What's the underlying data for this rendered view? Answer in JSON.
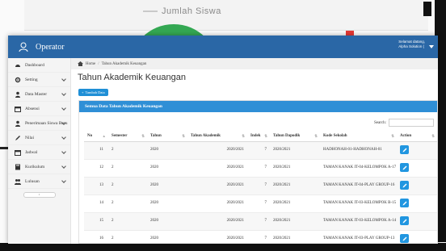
{
  "background": {
    "header_text": "Jumlah Siswa"
  },
  "app": {
    "name": "Operator",
    "user_line1": "Selamat datang,",
    "user_line2": "Alpha Solution (",
    "accent_color": "#2a67a6",
    "panel_color": "#2f8fd6"
  },
  "sidebar": {
    "items": [
      {
        "label": "Dashboard",
        "icon": "dashboard-icon",
        "has_caret": false
      },
      {
        "label": "Setting",
        "icon": "gear-icon",
        "has_caret": true
      },
      {
        "label": "Data Master",
        "icon": "user-icon",
        "has_caret": true
      },
      {
        "label": "Absensi",
        "icon": "calendar-icon",
        "has_caret": true
      },
      {
        "label": "Penerimaan Siswa Baru",
        "icon": "user-icon",
        "has_caret": true
      },
      {
        "label": "Nilai",
        "icon": "pencil-icon",
        "has_caret": true
      },
      {
        "label": "Jadwal",
        "icon": "calendar-icon",
        "has_caret": true
      },
      {
        "label": "Kurikulum",
        "icon": "book-icon",
        "has_caret": true
      },
      {
        "label": "Lulusan",
        "icon": "users-icon",
        "has_caret": true
      }
    ],
    "collapse_label": "‹"
  },
  "breadcrumb": {
    "home": "Home",
    "current": "Tahun Akademik Keuangan"
  },
  "page": {
    "title": "Tahun Akademik Keuangan",
    "add_button": "Tambah Data",
    "panel_title": "Semua Data Tahun Akademik Keuangan",
    "search_label": "Search:"
  },
  "table": {
    "columns": [
      "No",
      "Semester",
      "Tahun",
      "Tahun Akademik",
      "Indek",
      "Tahun Dapodik",
      "Kode Sekolah",
      "Action"
    ],
    "rows": [
      {
        "no": "11",
        "semester": "2",
        "tahun": "2020",
        "tahun_akademik": "2020/2021",
        "indek": "7",
        "tahun_dapodik": "2020/2021",
        "kode_sekolah": "HADHONAH-01-HADHONAH-01"
      },
      {
        "no": "12",
        "semester": "2",
        "tahun": "2020",
        "tahun_akademik": "2020/2021",
        "indek": "7",
        "tahun_dapodik": "2020/2021",
        "kode_sekolah": "TAMAN KANAK IT-04-KELOMPOK A-17"
      },
      {
        "no": "13",
        "semester": "2",
        "tahun": "2020",
        "tahun_akademik": "2020/2021",
        "indek": "7",
        "tahun_dapodik": "2020/2021",
        "kode_sekolah": "TAMAN KANAK IT-04-PLAY GROUP-16"
      },
      {
        "no": "14",
        "semester": "2",
        "tahun": "2020",
        "tahun_akademik": "2020/2021",
        "indek": "7",
        "tahun_dapodik": "2020/2021",
        "kode_sekolah": "TAMAN KANAK IT-03-KELOMPOK B-15"
      },
      {
        "no": "15",
        "semester": "2",
        "tahun": "2020",
        "tahun_akademik": "2020/2021",
        "indek": "7",
        "tahun_dapodik": "2020/2021",
        "kode_sekolah": "TAMAN KANAK IT-03-KELOMPOK A-14"
      },
      {
        "no": "16",
        "semester": "2",
        "tahun": "2020",
        "tahun_akademik": "2020/2021",
        "indek": "7",
        "tahun_dapodik": "2020/2021",
        "kode_sekolah": "TAMAN KANAK IT-03-PLAY GROUP-13"
      }
    ]
  }
}
